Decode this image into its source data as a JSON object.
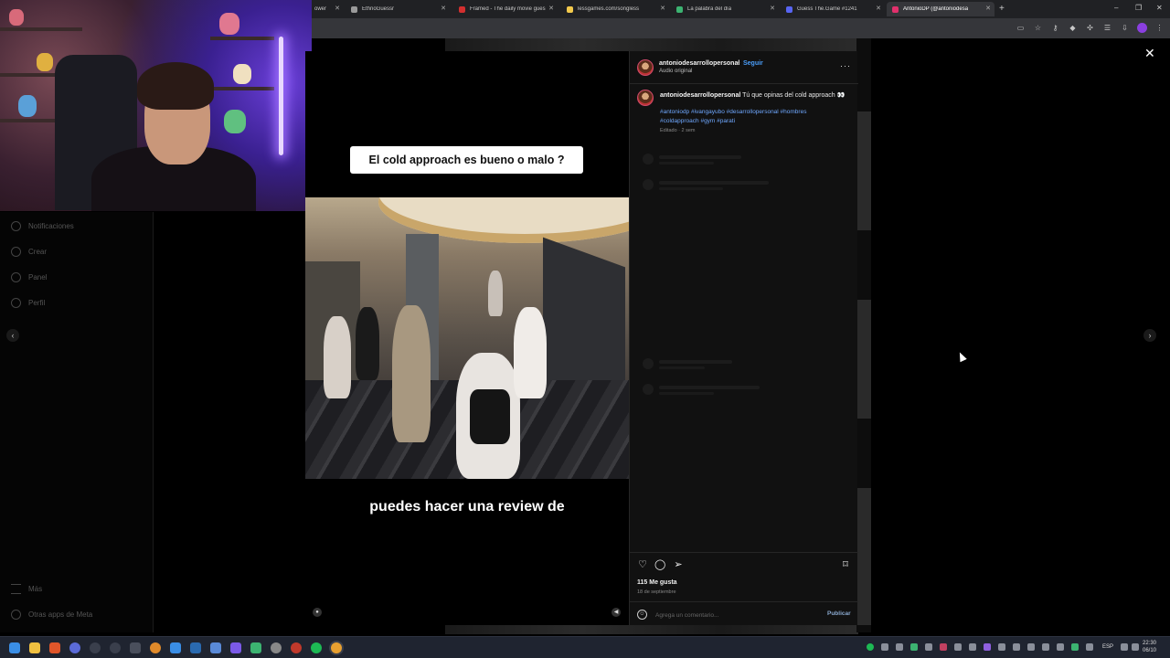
{
  "browser": {
    "tabs": [
      {
        "label": "ower",
        "favicon_color": "#555555"
      },
      {
        "label": "EthnoGuessr",
        "favicon_color": "#9a9a9a"
      },
      {
        "label": "Framed - The daily movie gues",
        "favicon_color": "#d32f2f"
      },
      {
        "label": "lessgames.com/songless",
        "favicon_color": "#f2c94c"
      },
      {
        "label": "La palabra del día",
        "favicon_color": "#3cb371"
      },
      {
        "label": "Guess The.Game #1241",
        "favicon_color": "#5865f2"
      },
      {
        "label": "AntonioDP (@antoniodesa",
        "favicon_color": "#e1306c"
      }
    ],
    "new_tab_label": "+",
    "window_controls": {
      "minimize": "–",
      "maximize": "❐",
      "close": "✕"
    }
  },
  "sidebar": {
    "items": [
      {
        "label": "Notificaciones",
        "icon": "heart-icon"
      },
      {
        "label": "Crear",
        "icon": "plus-icon"
      },
      {
        "label": "Panel",
        "icon": "dashboard-icon"
      },
      {
        "label": "Perfil",
        "icon": "profile-icon"
      }
    ],
    "more_label": "Más",
    "meta_label": "Otras apps de Meta"
  },
  "modal": {
    "close_label": "✕",
    "prev_label": "‹",
    "next_label": "›"
  },
  "video": {
    "caption": "El cold approach es bueno o malo ?",
    "subtitle": "puedes hacer una review de"
  },
  "post": {
    "username": "antoniodesarrollopersonal",
    "follow_label": "Seguir",
    "separator": "•",
    "audio_label": "Audio original",
    "more_label": "···",
    "caption_text": "Tú que opinas del cold approach 👀",
    "hashtags": "#antoniodp #ivangayubo #desarrollopersonal #hombres #coldapproach #gym #parati",
    "edited": "Editado · 2 sem",
    "likes": "115 Me gusta",
    "date": "18 de septiembre",
    "comment_placeholder": "Agrega un comentario...",
    "publish_label": "Publicar"
  },
  "taskbar": {
    "language": "ESP",
    "time": "22:30",
    "date": "06/10"
  },
  "colors": {
    "link_blue": "#4a9df8",
    "hashtag_blue": "#6fa8ff",
    "panel_bg": "#111111"
  }
}
